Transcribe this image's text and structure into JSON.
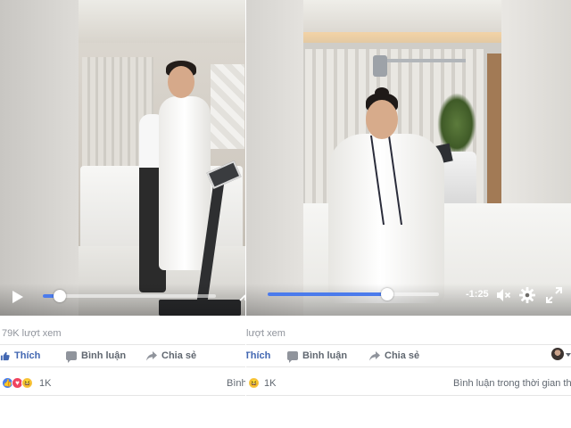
{
  "left_post": {
    "views": "79K lượt xem",
    "actions": {
      "like": "Thích",
      "comment": "Bình luận",
      "share": "Chia sẻ"
    },
    "reaction_count": "1K",
    "side_link": "Bình",
    "progress_fraction": 0.1
  },
  "right_post": {
    "views": "lượt xem",
    "actions": {
      "like": "Thích",
      "comment": "Bình luận",
      "share": "Chia sẻ"
    },
    "reaction_count": "1K",
    "side_link": "Bình luận trong thời gian thực",
    "time_remaining": "-1:25",
    "progress_fraction": 0.7
  },
  "icons": [
    "play-icon",
    "mute-icon",
    "gear-icon",
    "fullscreen-icon",
    "like-thumb-icon",
    "comment-icon",
    "share-icon",
    "reaction-like-icon",
    "reaction-love-icon",
    "reaction-haha-icon",
    "avatar"
  ],
  "colors": {
    "facebook_blue": "#4267b2",
    "progress_blue": "#4b7bec",
    "text_gray": "#606770"
  }
}
